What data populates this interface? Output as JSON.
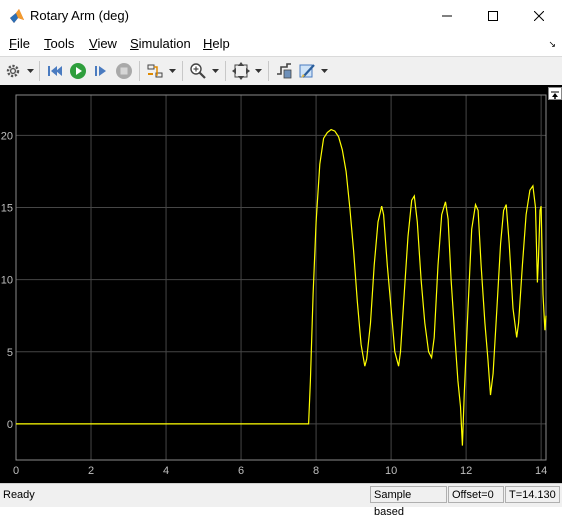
{
  "window": {
    "title": "Rotary Arm (deg)",
    "app_icon": "matlab-icon",
    "controls": [
      "minimize-icon",
      "maximize-icon",
      "close-icon"
    ]
  },
  "menu": {
    "items": [
      {
        "label": "File",
        "mnemonic": "F",
        "rest": "ile"
      },
      {
        "label": "Tools",
        "mnemonic": "T",
        "rest": "ools"
      },
      {
        "label": "View",
        "mnemonic": "V",
        "rest": "iew"
      },
      {
        "label": "Simulation",
        "mnemonic": "S",
        "rest": "imulation"
      },
      {
        "label": "Help",
        "mnemonic": "H",
        "rest": "elp"
      }
    ]
  },
  "toolbar": {
    "buttons": [
      "settings-icon",
      "step-back-icon",
      "run-icon",
      "step-forward-icon",
      "stop-icon",
      "highlight-icon",
      "zoom-icon",
      "fit-to-view-icon",
      "signal-select-icon",
      "style-icon"
    ]
  },
  "colors": {
    "plot_background": "#000000",
    "grid": "#464646",
    "axis_text": "#bfbfbf",
    "signal": "#ffff00"
  },
  "chart_data": {
    "type": "line",
    "title": "",
    "xlabel": "",
    "ylabel": "",
    "xlim": [
      0,
      14.13
    ],
    "ylim": [
      -2.5,
      22.8
    ],
    "x_ticks": [
      0,
      2,
      4,
      6,
      8,
      10,
      12,
      14
    ],
    "y_ticks": [
      0,
      5,
      10,
      15,
      20
    ],
    "grid": true,
    "legend": "none",
    "series": [
      {
        "color": "#ffff00",
        "points": [
          [
            0,
            0
          ],
          [
            7.8,
            0
          ],
          [
            7.85,
            3
          ],
          [
            7.92,
            9
          ],
          [
            8.0,
            14
          ],
          [
            8.1,
            18
          ],
          [
            8.2,
            19.8
          ],
          [
            8.3,
            20.2
          ],
          [
            8.4,
            20.4
          ],
          [
            8.5,
            20.3
          ],
          [
            8.6,
            19.9
          ],
          [
            8.7,
            19
          ],
          [
            8.8,
            17.5
          ],
          [
            8.9,
            15
          ],
          [
            9.0,
            12
          ],
          [
            9.1,
            8.5
          ],
          [
            9.2,
            5.5
          ],
          [
            9.3,
            4
          ],
          [
            9.35,
            4.5
          ],
          [
            9.45,
            7
          ],
          [
            9.55,
            11
          ],
          [
            9.65,
            14
          ],
          [
            9.75,
            15.1
          ],
          [
            9.8,
            14.5
          ],
          [
            9.9,
            11
          ],
          [
            10.0,
            8
          ],
          [
            10.1,
            5
          ],
          [
            10.2,
            4
          ],
          [
            10.25,
            5
          ],
          [
            10.35,
            9
          ],
          [
            10.45,
            13
          ],
          [
            10.55,
            15.5
          ],
          [
            10.62,
            15.8
          ],
          [
            10.7,
            14
          ],
          [
            10.8,
            10
          ],
          [
            10.9,
            7
          ],
          [
            11.0,
            5
          ],
          [
            11.08,
            4.6
          ],
          [
            11.15,
            6
          ],
          [
            11.25,
            11
          ],
          [
            11.35,
            14.5
          ],
          [
            11.45,
            15.4
          ],
          [
            11.52,
            14.2
          ],
          [
            11.6,
            10
          ],
          [
            11.7,
            6
          ],
          [
            11.78,
            3
          ],
          [
            11.85,
            1.2
          ],
          [
            11.9,
            -1.5
          ],
          [
            11.95,
            2
          ],
          [
            12.05,
            8
          ],
          [
            12.15,
            13.5
          ],
          [
            12.25,
            15.2
          ],
          [
            12.32,
            14.8
          ],
          [
            12.4,
            11
          ],
          [
            12.5,
            7
          ],
          [
            12.58,
            4.5
          ],
          [
            12.65,
            2
          ],
          [
            12.72,
            3.5
          ],
          [
            12.82,
            8
          ],
          [
            12.92,
            12.5
          ],
          [
            13.0,
            14.8
          ],
          [
            13.07,
            15.2
          ],
          [
            13.15,
            12.5
          ],
          [
            13.25,
            8
          ],
          [
            13.35,
            6
          ],
          [
            13.4,
            7
          ],
          [
            13.5,
            11
          ],
          [
            13.6,
            14.5
          ],
          [
            13.7,
            16.2
          ],
          [
            13.78,
            16.5
          ],
          [
            13.85,
            15
          ],
          [
            13.9,
            9.8
          ],
          [
            13.93,
            11.5
          ],
          [
            13.97,
            14.8
          ],
          [
            14.0,
            15.1
          ],
          [
            14.05,
            9
          ],
          [
            14.1,
            6.5
          ],
          [
            14.13,
            7.5
          ]
        ]
      }
    ]
  },
  "status": {
    "ready": "Ready",
    "sample_mode": "Sample based",
    "offset": "Offset=0",
    "time": "T=14.130"
  }
}
